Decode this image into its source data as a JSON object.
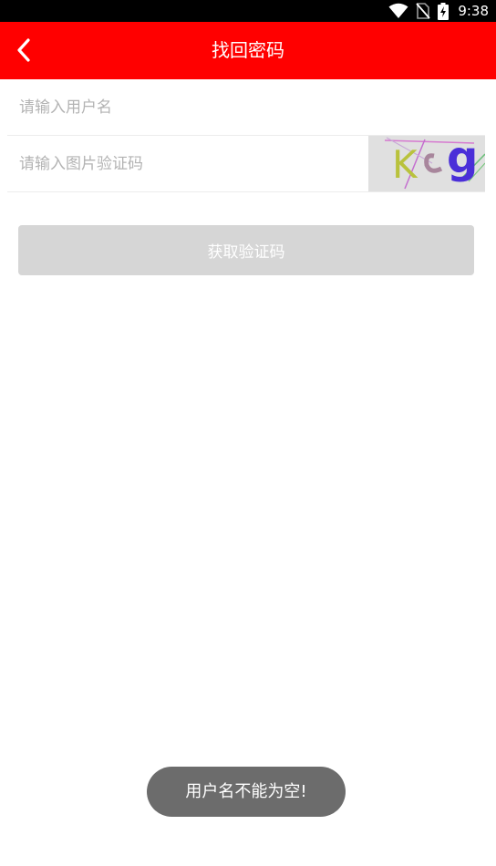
{
  "status_bar": {
    "time": "9:38",
    "icons": [
      "wifi-icon",
      "no-sim-icon",
      "battery-charging-icon"
    ]
  },
  "app_bar": {
    "title": "找回密码",
    "back_icon": "chevron-left-icon",
    "background": "#ff0000"
  },
  "form": {
    "username_placeholder": "请输入用户名",
    "captcha_placeholder": "请输入图片验证码",
    "captcha_chars": [
      "K",
      "g"
    ]
  },
  "get_code_button": {
    "label": "获取验证码"
  },
  "toast": {
    "message": "用户名不能为空!"
  }
}
